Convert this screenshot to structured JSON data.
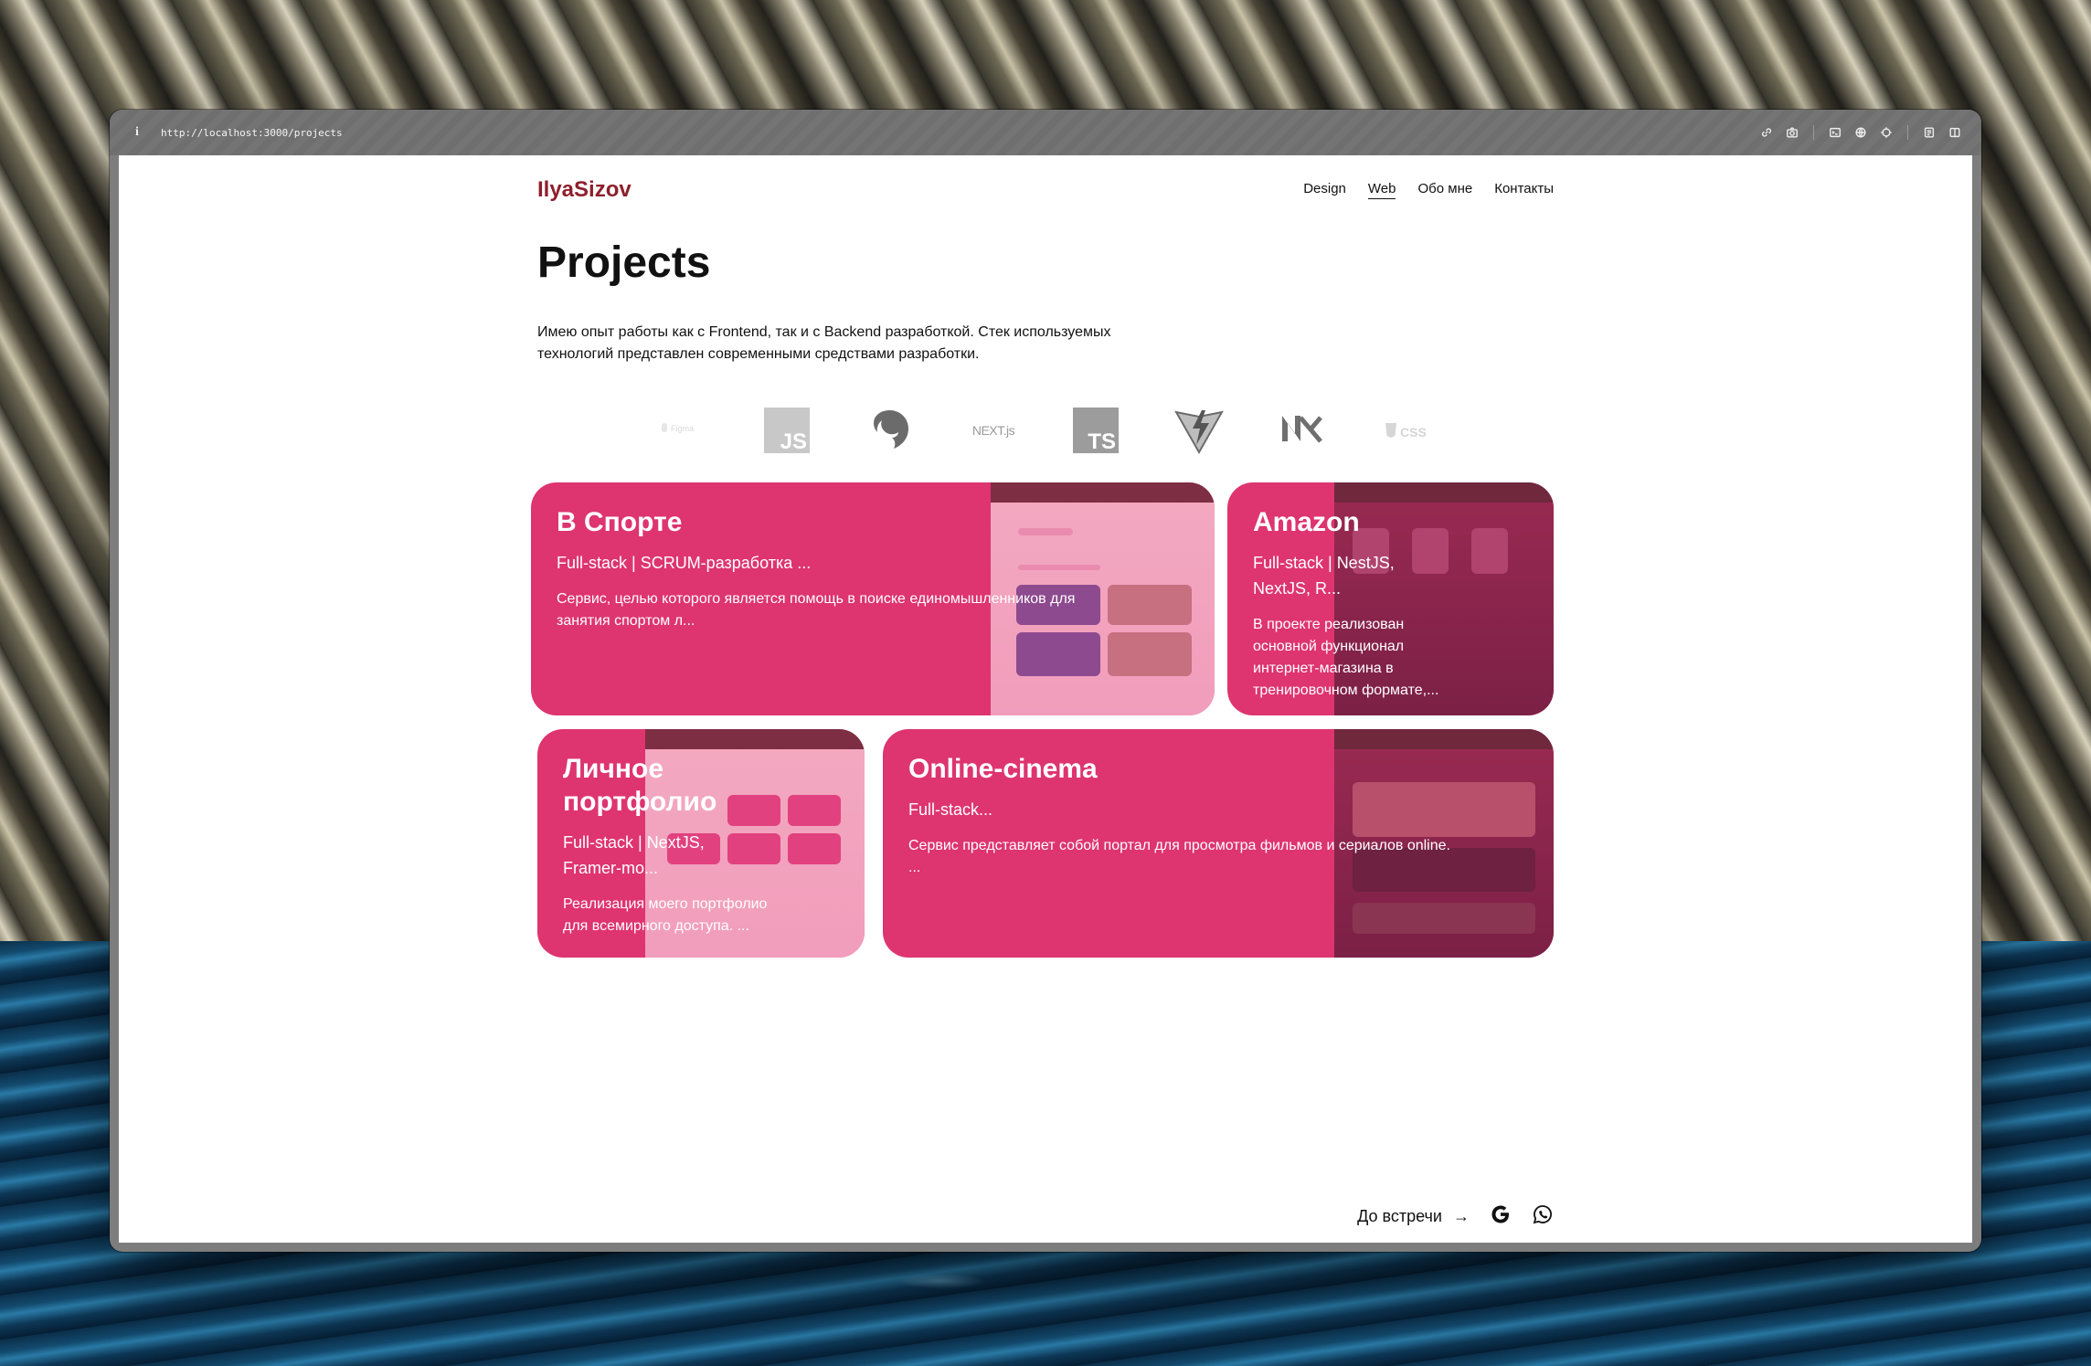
{
  "browser": {
    "url": "http://localhost:3000/projects"
  },
  "site": {
    "logo": "IlyaSizov",
    "nav": [
      "Design",
      "Web",
      "Обо мне",
      "Контакты"
    ],
    "active_nav": "Web"
  },
  "page": {
    "title": "Projects",
    "lead": "Имею опыт работы как с Frontend, так и с Backend разработкой. Стек используемых технологий представлен современными средствами разработки."
  },
  "techs": [
    {
      "name": "Figma",
      "icon": "figma-icon"
    },
    {
      "name": "JS",
      "icon": "javascript-icon"
    },
    {
      "name": "NestJS",
      "icon": "nestjs-icon"
    },
    {
      "name": "NEXT.js",
      "icon": "nextjs-icon"
    },
    {
      "name": "TS",
      "icon": "typescript-icon"
    },
    {
      "name": "Vite",
      "icon": "vite-icon"
    },
    {
      "name": "Nx",
      "icon": "nx-icon"
    },
    {
      "name": "CSS",
      "icon": "css-icon"
    }
  ],
  "projects": [
    {
      "title": "В Спорте",
      "stack": "Full-stack | SCRUM-разработка ...",
      "desc": "Сервис, целью которого является помощь в поиске единомышленников для занятия спортом л..."
    },
    {
      "title": "Amazon",
      "stack": "Full-stack | NestJS, NextJS, R...",
      "desc": "В проекте реализован основной функционал интернет-магазина в тренировочном формате,..."
    },
    {
      "title": "Личное портфолио",
      "stack": "Full-stack | NextJS, Framer-mo...",
      "desc": "Реализация моего портфолио для всемирного доступа. ..."
    },
    {
      "title": "Online-cinema",
      "stack": "Full-stack...",
      "desc": "Сервис представляет собой портал для просмотра фильмов и сериалов online. ..."
    }
  ],
  "footer": {
    "bye": "До встречи",
    "arrow": "→"
  },
  "colors": {
    "card": "#de3470",
    "logo": "#8e1f2c"
  }
}
